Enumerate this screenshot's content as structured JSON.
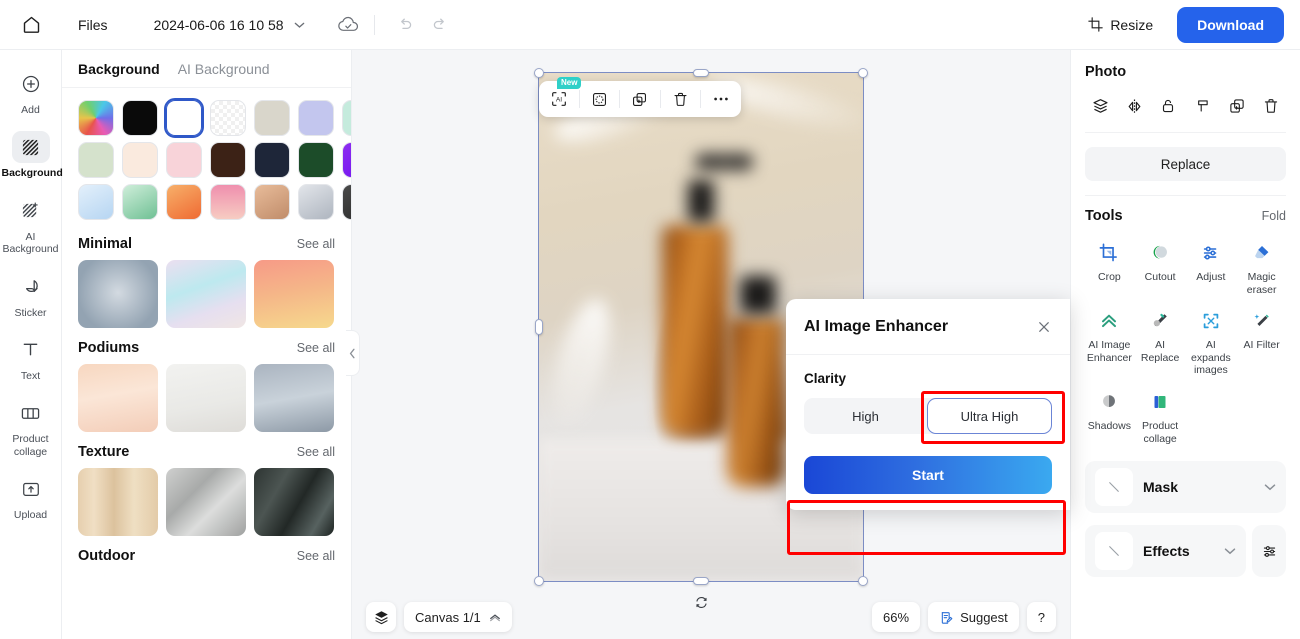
{
  "topbar": {
    "home_icon": "home-icon",
    "files_label": "Files",
    "filename": "2024-06-06 16 10 58",
    "filename_chevron": "chevron-down-icon",
    "cloud_icon": "cloud-saved-icon",
    "undo_icon": "undo-icon",
    "redo_icon": "redo-icon",
    "resize_label": "Resize",
    "resize_icon": "crop-resize-icon",
    "download_label": "Download",
    "download_color": "#2563eb"
  },
  "rail": {
    "items": [
      {
        "label": "Add",
        "icon": "plus-circle-icon",
        "active": false
      },
      {
        "label": "Background",
        "icon": "background-hatch-icon",
        "active": true
      },
      {
        "label": "AI Background",
        "icon": "ai-background-icon",
        "active": false
      },
      {
        "label": "Sticker",
        "icon": "sticker-icon",
        "active": false
      },
      {
        "label": "Text",
        "icon": "text-icon",
        "active": false
      },
      {
        "label": "Product collage",
        "icon": "product-collage-icon",
        "active": false
      },
      {
        "label": "Upload",
        "icon": "upload-icon",
        "active": false
      }
    ]
  },
  "panel": {
    "tabs": [
      {
        "label": "Background",
        "active": true
      },
      {
        "label": "AI Background",
        "active": false
      }
    ],
    "collapse_icon": "chevron-left-icon",
    "swatches": [
      {
        "name": "rainbow",
        "css": "conic-gradient(from 210deg, #e8534b, #e8c44b, #6fcf6f, #4bc7e8, #6f6fe8, #e85bb4, #e8534b)",
        "selected": false
      },
      {
        "name": "black",
        "css": "#0a0a0a",
        "selected": false
      },
      {
        "name": "white",
        "css": "#ffffff",
        "selected": true
      },
      {
        "name": "transparent",
        "css": "repeating-conic-gradient(#ffffff 0% 25%, #f0f0f0 0% 50%) 0 0/8px 8px",
        "selected": false
      },
      {
        "name": "beige",
        "css": "#d9d6cb",
        "selected": false
      },
      {
        "name": "periwinkle",
        "css": "#c3c6ee",
        "selected": false
      },
      {
        "name": "mint",
        "css": "#c5ebdd",
        "selected": false
      },
      {
        "name": "sage",
        "css": "#d5e2cc",
        "selected": false
      },
      {
        "name": "cream",
        "css": "#faeade",
        "selected": false
      },
      {
        "name": "blush-pink",
        "css": "#f8d3d9",
        "selected": false
      },
      {
        "name": "dark-brown",
        "css": "#3c2216",
        "selected": false
      },
      {
        "name": "navy",
        "css": "#1e2639",
        "selected": false
      },
      {
        "name": "forest-green",
        "css": "#1c4c29",
        "selected": false
      },
      {
        "name": "violet",
        "css": "linear-gradient(135deg,#8e2ef0,#6a0ff0)",
        "selected": false
      },
      {
        "name": "light-blue-gradient",
        "css": "linear-gradient(150deg,#e3f0fb,#b6d5f2)",
        "selected": false
      },
      {
        "name": "green-gradient",
        "css": "linear-gradient(150deg,#cfeeda,#6fc094)",
        "selected": false
      },
      {
        "name": "orange-gradient",
        "css": "linear-gradient(150deg,#f7b06a,#ef6a33)",
        "selected": false
      },
      {
        "name": "pink-gradient",
        "css": "linear-gradient(180deg,#ef8fae,#f7ccc2)",
        "selected": false
      },
      {
        "name": "tan-gradient",
        "css": "linear-gradient(150deg,#e8bc9a,#c08c6a)",
        "selected": false
      },
      {
        "name": "silver-gradient",
        "css": "linear-gradient(150deg,#e2e5ea,#aeb5bf)",
        "selected": false
      },
      {
        "name": "charcoal",
        "css": "linear-gradient(150deg,#4a4a4a,#2a2a2a)",
        "selected": false
      }
    ],
    "sections": [
      {
        "title": "Minimal",
        "see_all": "See all",
        "thumbs": [
          "radial-gradient(circle at 50% 48%, #d3dae1 0%, #93a3b2 75%)",
          "linear-gradient(160deg,#ecdff0 0%, #bde9ef 40%, #e6dff0 70%, #f0e6e4 100%)",
          "linear-gradient(170deg,#f79a87 0%, #f5b588 45%, #f6d98d 100%)"
        ]
      },
      {
        "title": "Podiums",
        "see_all": "See all",
        "thumbs": [
          "linear-gradient(170deg,#f7d7c0 0%, #fbe6d7 45%, #f3cdb8 100%)",
          "linear-gradient(170deg,#f2f2f0 0%, #e9e9e6 60%, #dedcd8 100%)",
          "linear-gradient(170deg,#aab4c0 0%, #c9d2da 50%, #8d99a6 100%)"
        ]
      },
      {
        "title": "Texture",
        "see_all": "See all",
        "thumbs": [
          "linear-gradient(90deg,#e6cfae 0%, #f0dfc4 20%, #dcc29d 45%, #efdfc3 70%, #e3cba8 100%)",
          "linear-gradient(135deg,#cfd0cf 0%, #a8aaa9 35%, #dcdddc 60%, #9fa1a0 100%)",
          "linear-gradient(120deg,#2d3432 0%, #4c5552 30%, #222826 55%, #576260 80%, #1c2220 100%)"
        ]
      },
      {
        "title": "Outdoor",
        "see_all": "See all",
        "thumbs": []
      }
    ]
  },
  "canvas": {
    "float_toolbar": [
      {
        "icon": "ai-enhance-icon",
        "badge": "New"
      },
      {
        "icon": "cutout-circle-icon",
        "badge": ""
      },
      {
        "icon": "duplicate-icon",
        "badge": ""
      },
      {
        "icon": "delete-trash-icon",
        "badge": ""
      },
      {
        "icon": "more-dots-icon",
        "badge": ""
      }
    ],
    "rotate_icon": "rotate-icon",
    "image_description": "blurred amber dropper bottles on beige surface"
  },
  "bottombar": {
    "layers_icon": "layers-icon",
    "canvas_label": "Canvas 1/1",
    "canvas_chevron": "chevron-up-icon",
    "zoom_level": "66%",
    "suggest_label": "Suggest",
    "suggest_icon": "suggest-clipboard-icon",
    "help_label": "?"
  },
  "right": {
    "photo_title": "Photo",
    "icons": [
      "layers-order-icon",
      "flip-icon",
      "lock-icon",
      "align-icon",
      "duplicate-icon",
      "delete-trash-icon"
    ],
    "replace_label": "Replace",
    "tools_title": "Tools",
    "fold_label": "Fold",
    "tools": [
      {
        "label": "Crop",
        "icon": "crop-icon"
      },
      {
        "label": "Cutout",
        "icon": "cutout-icon"
      },
      {
        "label": "Adjust",
        "icon": "adjust-icon"
      },
      {
        "label": "Magic eraser",
        "icon": "magic-eraser-icon"
      },
      {
        "label": "AI Image Enhancer",
        "icon": "ai-enhancer-icon"
      },
      {
        "label": "AI Replace",
        "icon": "ai-replace-icon"
      },
      {
        "label": "AI expands images",
        "icon": "ai-expand-icon"
      },
      {
        "label": "AI Filter",
        "icon": "ai-filter-icon"
      },
      {
        "label": "Shadows",
        "icon": "shadows-icon"
      },
      {
        "label": "Product collage",
        "icon": "product-collage-icon"
      }
    ],
    "mask_label": "Mask",
    "effects_label": "Effects",
    "mask_chevron": "chevron-down-icon",
    "effects_chevron": "chevron-down-icon",
    "effects_settings_icon": "sliders-icon"
  },
  "dialog": {
    "title": "AI Image Enhancer",
    "close_icon": "close-icon",
    "clarity_label": "Clarity",
    "options": [
      {
        "label": "High",
        "selected": false
      },
      {
        "label": "Ultra High",
        "selected": true
      }
    ],
    "start_label": "Start",
    "annotation_color": "#ff0000"
  }
}
